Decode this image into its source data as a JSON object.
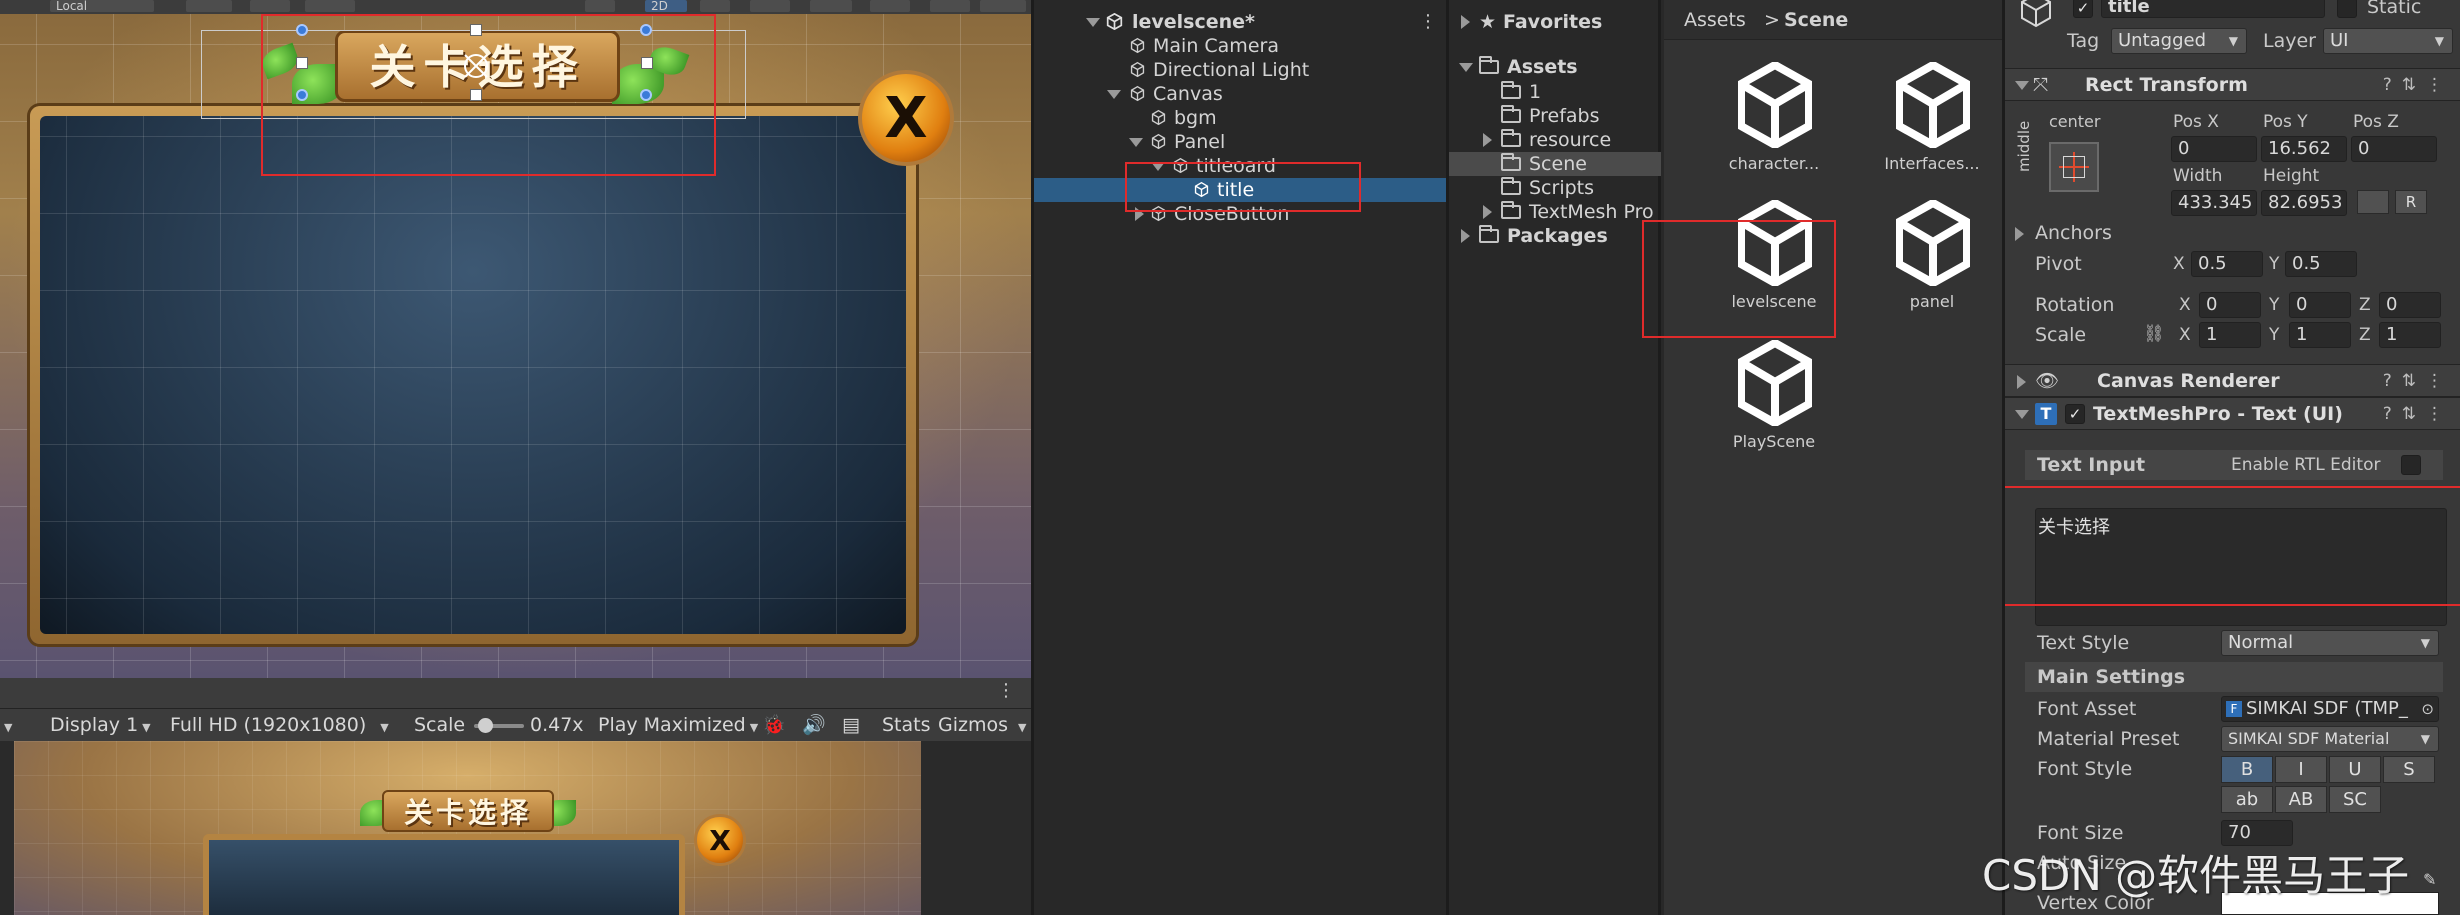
{
  "scene_view": {
    "toolbar": {
      "pivot_label": "Local",
      "mode_2d": "2D"
    },
    "title_plaque_text": "关卡选择"
  },
  "game_view": {
    "display": "Display 1",
    "resolution": "Full HD (1920x1080)",
    "scale_label": "Scale",
    "scale_value": "0.47x",
    "play_mode": "Play Maximized",
    "stats": "Stats",
    "gizmos": "Gizmos",
    "plaque_text": "关卡选择"
  },
  "hierarchy": {
    "scene_name": "levelscene*",
    "items": [
      {
        "label": "Main Camera"
      },
      {
        "label": "Directional Light"
      },
      {
        "label": "Canvas"
      },
      {
        "label": "bgm"
      },
      {
        "label": "Panel"
      },
      {
        "label": "titleoard"
      },
      {
        "label": "title"
      },
      {
        "label": "CloseButton"
      }
    ]
  },
  "project": {
    "favorites": "Favorites",
    "assets": "Assets",
    "folders": [
      "1",
      "Prefabs",
      "resource",
      "Scene",
      "Scripts",
      "TextMesh Pro"
    ],
    "packages": "Packages",
    "breadcrumb": {
      "root": "Assets",
      "separator": ">",
      "current": "Scene"
    },
    "items": [
      {
        "label": "character..."
      },
      {
        "label": "Interfaces..."
      },
      {
        "label": "levelscene"
      },
      {
        "label": "panel"
      },
      {
        "label": "PlayScene"
      }
    ]
  },
  "inspector": {
    "object_name": "title",
    "static_label": "Static",
    "tag_label": "Tag",
    "tag_value": "Untagged",
    "layer_label": "Layer",
    "layer_value": "UI",
    "rect_transform": {
      "title": "Rect Transform",
      "anchor_h": "center",
      "anchor_v": "middle",
      "pos_x_label": "Pos X",
      "pos_x": "0",
      "pos_y_label": "Pos Y",
      "pos_y": "16.562",
      "pos_z_label": "Pos Z",
      "pos_z": "0",
      "width_label": "Width",
      "width": "433.345",
      "height_label": "Height",
      "height": "82.6953",
      "blueprint_btn": "",
      "raw_btn": "R",
      "anchors_label": "Anchors",
      "pivot_label": "Pivot",
      "pivot_x": "0.5",
      "pivot_y": "0.5",
      "rotation_label": "Rotation",
      "rot_x": "0",
      "rot_y": "0",
      "rot_z": "0",
      "scale_label": "Scale",
      "scale_x": "1",
      "scale_y": "1",
      "scale_z": "1",
      "x": "X",
      "y": "Y",
      "z": "Z"
    },
    "canvas_renderer": {
      "title": "Canvas Renderer"
    },
    "tmp": {
      "title": "TextMeshPro - Text (UI)",
      "text_input_label": "Text Input",
      "rtl_label": "Enable RTL Editor",
      "text_value": "关卡选择",
      "text_style_label": "Text Style",
      "text_style_value": "Normal",
      "main_settings": "Main Settings",
      "font_asset_label": "Font Asset",
      "font_asset_value": "SIMKAI SDF (TMP_",
      "material_preset_label": "Material Preset",
      "material_preset_value": "SIMKAI SDF Material",
      "font_style_label": "Font Style",
      "font_style_buttons": [
        "B",
        "I",
        "U",
        "S",
        "ab",
        "AB",
        "SC"
      ],
      "font_size_label": "Font Size",
      "font_size_value": "70",
      "auto_size_label": "Auto Size",
      "vertex_color_label": "Vertex Color"
    }
  },
  "watermark": "CSDN @软件黑马王子"
}
